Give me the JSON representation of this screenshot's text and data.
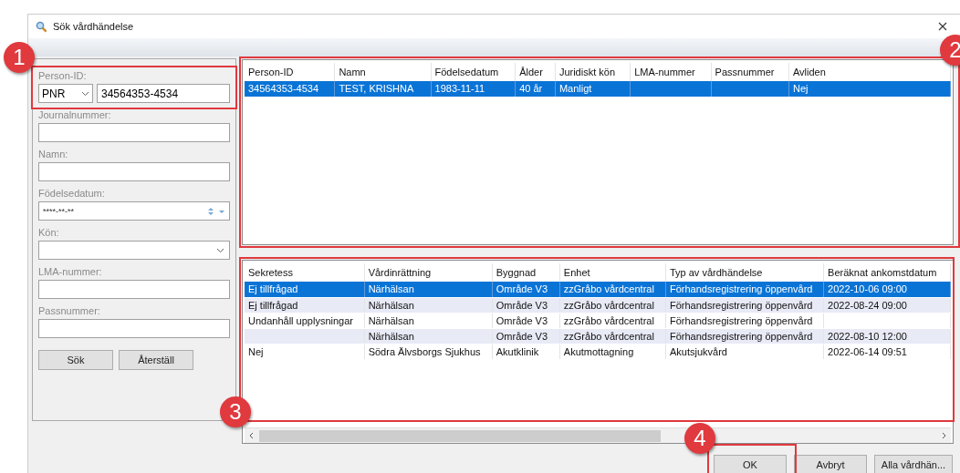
{
  "window": {
    "title": "Sök vårdhändelse"
  },
  "search_panel": {
    "person_id": {
      "label": "Person-ID:",
      "id_type": "PNR",
      "value": "34564353-4534"
    },
    "fields": [
      {
        "kind": "text",
        "label": "Journalnummer:"
      },
      {
        "kind": "text",
        "label": "Namn:"
      },
      {
        "kind": "date",
        "label": "Födelsedatum:",
        "value": "****-**-**"
      },
      {
        "kind": "dropdown",
        "label": "Kön:"
      },
      {
        "kind": "text",
        "label": "LMA-nummer:"
      },
      {
        "kind": "text",
        "label": "Passnummer:"
      }
    ],
    "buttons": [
      "Sök",
      "Återställ"
    ]
  },
  "patients": {
    "columns": [
      "Person-ID",
      "Namn",
      "Födelsedatum",
      "Ålder",
      "Juridiskt kön",
      "LMA-nummer",
      "Passnummer",
      "Avliden"
    ],
    "rows": [
      {
        "selected": true,
        "cells": [
          "34564353-4534",
          "TEST, KRISHNA",
          "1983-11-11",
          "40 år",
          "Manligt",
          null,
          null,
          "Nej"
        ]
      }
    ]
  },
  "events": {
    "columns": [
      "Sekretess",
      "Vårdinrättning",
      "Byggnad",
      "Enhet",
      "Typ av vårdhändelse",
      "Beräknat ankomstdatum"
    ],
    "rows": [
      {
        "selected": true,
        "cells": [
          "Ej tillfrågad",
          "Närhälsan",
          "Område V3",
          "zzGråbo vårdcentral",
          "Förhandsregistrering öppenvård",
          "2022-10-06 09:00"
        ]
      },
      {
        "selected": false,
        "cells": [
          "Ej tillfrågad",
          "Närhälsan",
          "Område V3",
          "zzGråbo vårdcentral",
          "Förhandsregistrering öppenvård",
          "2022-08-24 09:00"
        ]
      },
      {
        "selected": false,
        "cells": [
          "Undanhåll upplysningar",
          "Närhälsan",
          "Område V3",
          "zzGråbo vårdcentral",
          "Förhandsregistrering öppenvård",
          null
        ]
      },
      {
        "selected": false,
        "cells": [
          null,
          "Närhälsan",
          "Område V3",
          "zzGråbo vårdcentral",
          "Förhandsregistrering öppenvård",
          "2022-08-10 12:00"
        ]
      },
      {
        "selected": false,
        "cells": [
          "Nej",
          "Södra Älvsborgs Sjukhus",
          "Akutklinik",
          "Akutmottagning",
          "Akutsjukvård",
          "2022-06-14 09:51"
        ]
      }
    ]
  },
  "buttons": [
    "OK",
    "Avbryt",
    "Alla vårdhän..."
  ],
  "callouts": [
    "1",
    "2",
    "3",
    "4"
  ]
}
